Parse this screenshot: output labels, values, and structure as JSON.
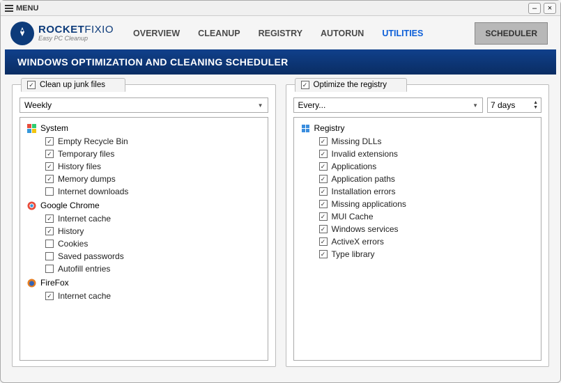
{
  "titlebar": {
    "menu": "MENU"
  },
  "brand": {
    "name_bold": "ROCKET",
    "name_light": "FIXIO",
    "tagline": "Easy PC Cleanup"
  },
  "nav": {
    "items": [
      "OVERVIEW",
      "CLEANUP",
      "REGISTRY",
      "AUTORUN",
      "UTILITIES"
    ],
    "scheduler": "SCHEDULER"
  },
  "banner": "WINDOWS OPTIMIZATION AND CLEANING SCHEDULER",
  "left": {
    "title": "Clean up junk files",
    "title_checked": true,
    "select": "Weekly",
    "groups": [
      {
        "name": "System",
        "icon": "windows",
        "items": [
          {
            "label": "Empty Recycle Bin",
            "checked": true
          },
          {
            "label": "Temporary files",
            "checked": true
          },
          {
            "label": "History files",
            "checked": true
          },
          {
            "label": "Memory dumps",
            "checked": true
          },
          {
            "label": "Internet downloads",
            "checked": false
          }
        ]
      },
      {
        "name": "Google Chrome",
        "icon": "chrome",
        "items": [
          {
            "label": "Internet cache",
            "checked": true
          },
          {
            "label": "History",
            "checked": true
          },
          {
            "label": "Cookies",
            "checked": false
          },
          {
            "label": "Saved passwords",
            "checked": false
          },
          {
            "label": "Autofill entries",
            "checked": false
          }
        ]
      },
      {
        "name": "FireFox",
        "icon": "firefox",
        "items": [
          {
            "label": "Internet cache",
            "checked": true
          }
        ]
      }
    ]
  },
  "right": {
    "title": "Optimize the registry",
    "title_checked": true,
    "select": "Every...",
    "stepper": "7 days",
    "groups": [
      {
        "name": "Registry",
        "icon": "registry",
        "items": [
          {
            "label": "Missing DLLs",
            "checked": true
          },
          {
            "label": "Invalid extensions",
            "checked": true
          },
          {
            "label": "Applications",
            "checked": true
          },
          {
            "label": "Application paths",
            "checked": true
          },
          {
            "label": "Installation errors",
            "checked": true
          },
          {
            "label": "Missing applications",
            "checked": true
          },
          {
            "label": "MUI Cache",
            "checked": true
          },
          {
            "label": "Windows services",
            "checked": true
          },
          {
            "label": "ActiveX errors",
            "checked": true
          },
          {
            "label": "Type library",
            "checked": true
          }
        ]
      }
    ]
  }
}
